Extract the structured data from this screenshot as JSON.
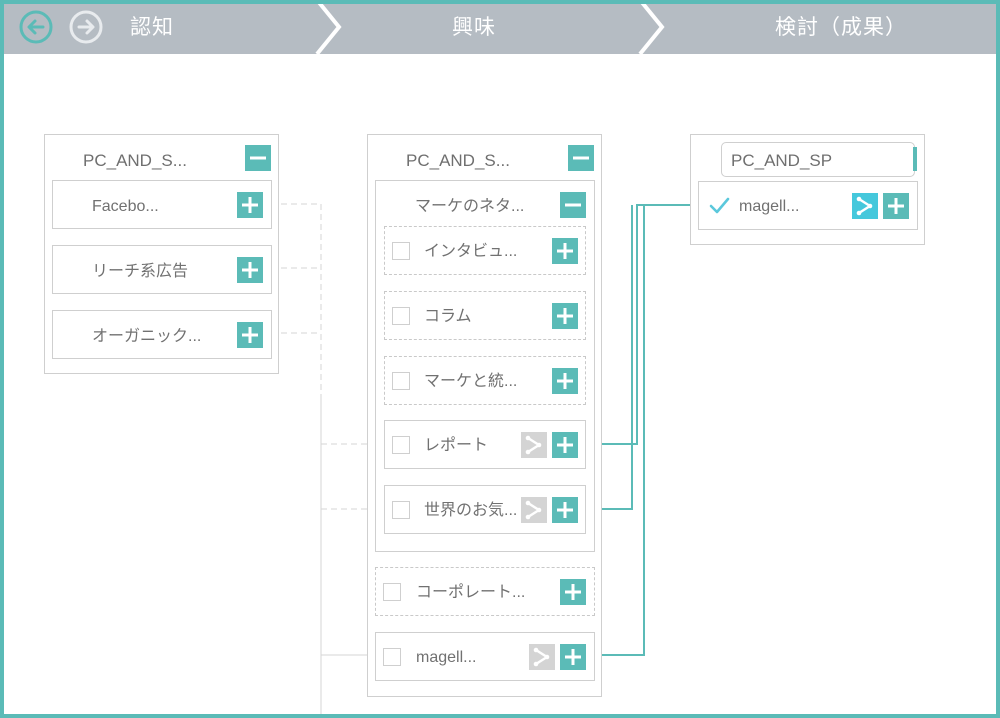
{
  "stages": {
    "awareness": "認知",
    "interest": "興味",
    "consideration": "検討（成果）"
  },
  "colors": {
    "accent": "#5bbbb7",
    "header": "#b5bcc3",
    "border_frame": "#5bbbb7"
  },
  "col1": {
    "title": "PC_AND_S...",
    "items": [
      "Facebo...",
      "リーチ系広告",
      "オーガニック..."
    ]
  },
  "col2": {
    "title": "PC_AND_S...",
    "group": {
      "title": "マーケのネタ...",
      "items": [
        "インタビュ...",
        "コラム",
        "マーケと統...",
        "レポート",
        "世界のお気..."
      ]
    },
    "items": [
      "コーポレート...",
      "magell..."
    ]
  },
  "col3": {
    "title": "PC_AND_SP",
    "items": [
      "magell..."
    ]
  }
}
